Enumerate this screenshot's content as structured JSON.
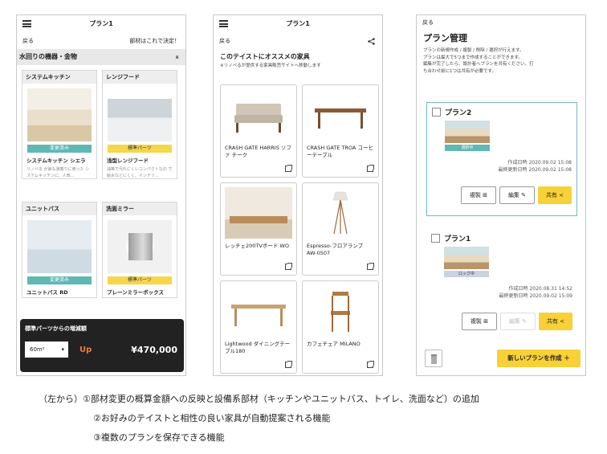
{
  "p1": {
    "title": "プラン1",
    "back": "戻る",
    "decide": "部材はこれで決定！",
    "category": "水回りの機器・金物",
    "cards": [
      {
        "head": "システムキッチン",
        "badge": "変更済み",
        "name": "システムキッチン シエラ",
        "desc": "リノベる が最も演奏りに使った システムキッチンに、人気…"
      },
      {
        "head": "レンジフード",
        "badge": "標準パーツ",
        "name": "浅型レンジフード",
        "desc": "油等で汚れにくいコンパクトなの で給水などにくく、インテリ…"
      },
      {
        "head": "ユニットバス",
        "badge": "変更済み",
        "name": "ユニットバス RD",
        "desc": ""
      },
      {
        "head": "洗面ミラー",
        "badge": "標準パーツ",
        "name": "プレーンミラーボックス",
        "desc": ""
      }
    ],
    "overlay": {
      "title": "標準パーツからの増減額",
      "size": "60m²",
      "direction": "Up",
      "price": "¥470,000"
    }
  },
  "p2": {
    "back": "戻る",
    "heading": "このテイストにオススメの家具",
    "sub": "※リノベるが提供する家具販売サイトへ移動します",
    "items": [
      {
        "name": "CRASH GATE HARRIS ソファ チーク"
      },
      {
        "name": "CRASH GATE TROA コーヒーテーブル"
      },
      {
        "name": "レッチェ200TVボード WO"
      },
      {
        "name": "Espresso-フロアランプ AW-0507"
      },
      {
        "name": "Lightwood ダイニングテーブル180"
      },
      {
        "name": "カフェチェア MILANO"
      }
    ]
  },
  "p3": {
    "back": "戻る",
    "title": "プラン管理",
    "desc": [
      "プランの新規作成 / 複製 / 削除 / 選択が行えます。",
      "プランは最大で5つまで作成することができます。",
      "編集が完了したら、設計者へプランを共有ください。打",
      "ち合わせ前に1つは共有が必要です。"
    ],
    "plans": [
      {
        "name": "プラン2",
        "badge": "選択中",
        "created": "作成日時 2020.09.02 15:08",
        "updated": "最終更新日時 2020.09.02 15:08"
      },
      {
        "name": "プラン1",
        "badge": "ロック中",
        "created": "作成日時 2020.08.31 14:52",
        "updated": "最終更新日時 2020.09.02 15:09"
      }
    ],
    "btn_copy": "複製",
    "btn_edit": "編集",
    "btn_share": "共有",
    "new_plan": "新しいプランを作成 ＋"
  },
  "caption": {
    "line1": "（左から）①部材変更の概算金額への反映と設備系部材（キッチンやユニットバス、トイレ、洗面など）の追加",
    "line2": "②お好みのテイストと相性の良い家具が自動提案される機能",
    "line3": "③複数のプランを保存できる機能"
  }
}
